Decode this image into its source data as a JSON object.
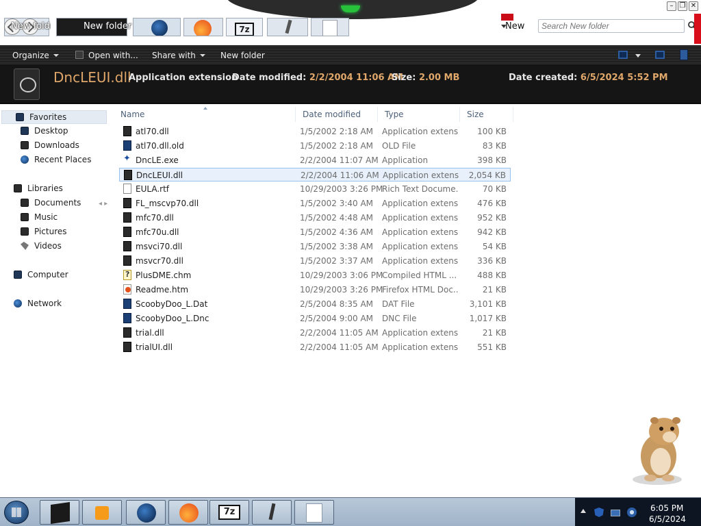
{
  "window": {
    "address_tabs": [
      "New folde",
      "New folder",
      "New"
    ],
    "search_placeholder": "Search New folder",
    "controls": [
      "–",
      "❐",
      "✕"
    ]
  },
  "commands": {
    "organize": "Organize",
    "open_with": "Open with...",
    "share_with": "Share with",
    "new_folder": "New folder"
  },
  "details": {
    "name": "DncLEUI.dll",
    "type": "Application extension",
    "date_modified_label": "Date modified:",
    "date_modified": "2/2/2004 11:06 AM",
    "size_label": "Size:",
    "size": "2.00 MB",
    "date_created_label": "Date created:",
    "date_created": "6/5/2024 5:52 PM"
  },
  "nav": {
    "favorites": "Favorites",
    "desktop": "Desktop",
    "downloads": "Downloads",
    "recent_places": "Recent Places",
    "libraries": "Libraries",
    "documents": "Documents",
    "music": "Music",
    "pictures": "Pictures",
    "videos": "Videos",
    "computer": "Computer",
    "network": "Network"
  },
  "columns": {
    "name": "Name",
    "date_modified": "Date modified",
    "type": "Type",
    "size": "Size"
  },
  "files": [
    {
      "name": "atl70.dll",
      "date": "1/5/2002 2:18 AM",
      "type": "Application extens...",
      "size": "100 KB",
      "icon": "dll"
    },
    {
      "name": "atl70.dll.old",
      "date": "1/5/2002 2:18 AM",
      "type": "OLD File",
      "size": "83 KB",
      "icon": "navy"
    },
    {
      "name": "DncLE.exe",
      "date": "2/2/2004 11:07 AM",
      "type": "Application",
      "size": "398 KB",
      "icon": "exe"
    },
    {
      "name": "DncLEUI.dll",
      "date": "2/2/2004 11:06 AM",
      "type": "Application extens...",
      "size": "2,054 KB",
      "icon": "dll",
      "selected": true
    },
    {
      "name": "EULA.rtf",
      "date": "10/29/2003 3:26 PM",
      "type": "Rich Text Docume...",
      "size": "70 KB",
      "icon": "doc"
    },
    {
      "name": "FL_mscvp70.dll",
      "date": "1/5/2002 3:40 AM",
      "type": "Application extens...",
      "size": "476 KB",
      "icon": "dll"
    },
    {
      "name": "mfc70.dll",
      "date": "1/5/2002 4:48 AM",
      "type": "Application extens...",
      "size": "952 KB",
      "icon": "dll"
    },
    {
      "name": "mfc70u.dll",
      "date": "1/5/2002 4:36 AM",
      "type": "Application extens...",
      "size": "942 KB",
      "icon": "dll"
    },
    {
      "name": "msvci70.dll",
      "date": "1/5/2002 3:38 AM",
      "type": "Application extens...",
      "size": "54 KB",
      "icon": "dll"
    },
    {
      "name": "msvcr70.dll",
      "date": "1/5/2002 3:37 AM",
      "type": "Application extens...",
      "size": "336 KB",
      "icon": "dll"
    },
    {
      "name": "PlusDME.chm",
      "date": "10/29/2003 3:06 PM",
      "type": "Compiled HTML ...",
      "size": "488 KB",
      "icon": "chm"
    },
    {
      "name": "Readme.htm",
      "date": "10/29/2003 3:26 PM",
      "type": "Firefox HTML Doc...",
      "size": "21 KB",
      "icon": "htm"
    },
    {
      "name": "ScoobyDoo_L.Dat",
      "date": "2/5/2004 8:35 AM",
      "type": "DAT File",
      "size": "3,101 KB",
      "icon": "navy"
    },
    {
      "name": "ScoobyDoo_L.Dnc",
      "date": "2/5/2004 9:00 AM",
      "type": "DNC File",
      "size": "1,017 KB",
      "icon": "navy"
    },
    {
      "name": "trial.dll",
      "date": "2/2/2004 11:05 AM",
      "type": "Application extens...",
      "size": "21 KB",
      "icon": "dll"
    },
    {
      "name": "trialUI.dll",
      "date": "2/2/2004 11:05 AM",
      "type": "Application extens...",
      "size": "551 KB",
      "icon": "dll"
    }
  ],
  "taskbar": {
    "apps": [
      "explorer-icon",
      "media-player-icon",
      "globe-icon",
      "firefox-icon",
      "7zip-icon",
      "pen-icon",
      "document-icon"
    ],
    "sevenzip_label": "7z",
    "time": "6:05 PM",
    "date": "6/5/2024"
  },
  "colors": {
    "accent_orange": "#e0a76a",
    "selection": "#e8f1fb",
    "tray": "#0d1522"
  }
}
